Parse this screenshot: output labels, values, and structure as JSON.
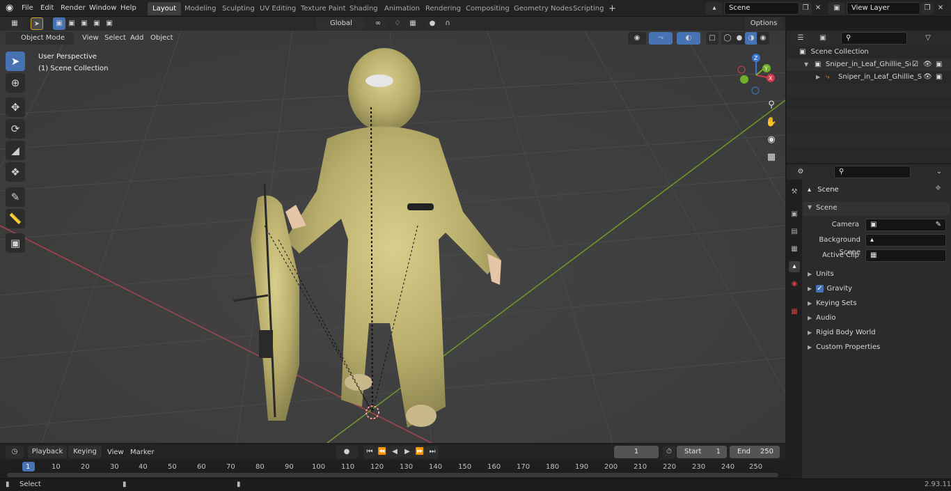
{
  "topbar": {
    "menus": [
      "File",
      "Edit",
      "Render",
      "Window",
      "Help"
    ],
    "workspaces": [
      "Layout",
      "Modeling",
      "Sculpting",
      "UV Editing",
      "Texture Paint",
      "Shading",
      "Animation",
      "Rendering",
      "Compositing",
      "Geometry Nodes",
      "Scripting"
    ],
    "active_workspace": "Layout",
    "add_tab": "+",
    "scene": "Scene",
    "view_layer": "View Layer"
  },
  "viewport_header": {
    "mode": "Object Mode",
    "menus": [
      "View",
      "Select",
      "Add",
      "Object"
    ],
    "transform": "Global",
    "options": "Options"
  },
  "viewport": {
    "perspective": "User Perspective",
    "collection": "(1) Scene Collection",
    "gizmo": {
      "x": "X",
      "y": "Y",
      "z": "Z"
    }
  },
  "outliner": {
    "root": "Scene Collection",
    "items": [
      "Sniper_in_Leaf_Ghillie_Suit_T",
      "Sniper_in_Leaf_Ghillie_Su"
    ]
  },
  "properties": {
    "header": "Scene",
    "panel": "Scene",
    "fields": [
      {
        "label": "Camera"
      },
      {
        "label": "Background Scene"
      },
      {
        "label": "Active Clip"
      }
    ],
    "sections": [
      "Units",
      "Gravity",
      "Keying Sets",
      "Audio",
      "Rigid Body World",
      "Custom Properties"
    ]
  },
  "timeline": {
    "menus": [
      "Playback",
      "Keying",
      "View",
      "Marker"
    ],
    "current_frame": "1",
    "start_label": "Start",
    "start": "1",
    "end_label": "End",
    "end": "250",
    "ticks": [
      "1",
      "10",
      "20",
      "30",
      "40",
      "50",
      "60",
      "70",
      "80",
      "90",
      "100",
      "110",
      "120",
      "130",
      "140",
      "150",
      "160",
      "170",
      "180",
      "190",
      "200",
      "210",
      "220",
      "230",
      "240",
      "250"
    ]
  },
  "status": {
    "left": "Select",
    "version": "2.93.11"
  }
}
